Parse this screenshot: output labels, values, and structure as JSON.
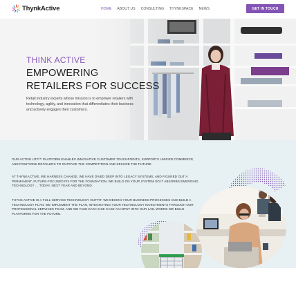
{
  "brand": {
    "name": "ThynkActive"
  },
  "nav": {
    "items": [
      {
        "label": "HOME",
        "active": true
      },
      {
        "label": "ABOUT US",
        "active": false
      },
      {
        "label": "CONSULTING",
        "active": false
      },
      {
        "label": "THYNKSPACE",
        "active": false
      },
      {
        "label": "NEWS",
        "active": false
      }
    ],
    "cta_label": "GET IN TOUCH"
  },
  "hero": {
    "kicker": "THINK ACTIVE",
    "title_line1": "EMPOWERING",
    "title_line2": "RETAILERS  FOR SUCCESS",
    "description": "Retail industry experts whose mission is to  empower retailers with technology, agility, and innovation that differentiates their business and actively engages their customers."
  },
  "content": {
    "paragraph1": "OUR ACTIVE UTP™ PLATFORM ENABLES INNOVATIVE CUSTOMER TOUCHPOINTS, SUPPORTS UNIFIED COMMERCE, AND POSITIONS RETAILERS TO OUTPACE THE COMPETITION AND SECURE THE FUTURE.",
    "paragraph2": "AT THYNKACTIVE, WE HARNESS CHANGE. WE HAVE DIVED DEEP INTO LEGACY SYSTEMS, AND FIGURED OUT A PERMANENT, FUTURE-FOCUSED FIX FOR THE FOUNDATION. WE BUILD ON YOUR SYSTEM SO IT ABSORBS EMERGING TECHNOLOGY … TODAY, NEXT YEAR AND BEYOND.",
    "paragraph3": "THYNK ACTIVE IS A FULL-SERVICE TECHNOLOGY OUTFIT. WE DESIGN YOUR BUSINESS PROCESSES AND BUILD A TECHNOLOGY PLAN. WE IMPLEMENT THE PLAN, INTEGRATING YOUR TECHNOLOGY INVESTMENTS THROUGH OUR PROFESSIONAL SERVICES TEAM, AND WE TAKE EACH USE CASE AS INPUT INTO OUR LAB, WHERE WE BUILD PLATFORMS FOR THE FUTURE."
  },
  "colors": {
    "accent": "#8354b5",
    "content_bg": "#e7f0f3",
    "hero_kicker": "#8a5ab8"
  }
}
